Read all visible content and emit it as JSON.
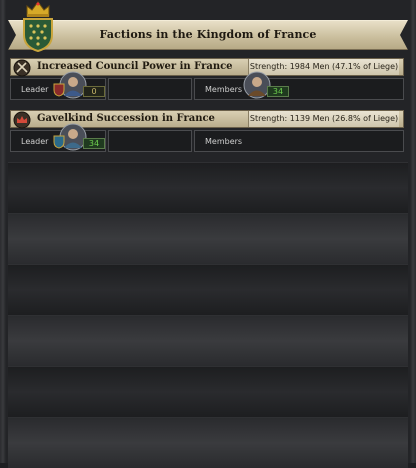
{
  "window": {
    "title": "Factions in the Kingdom of France"
  },
  "factions": [
    {
      "name": "Increased Council Power in France",
      "strength": "Strength: 1984 Men (47.1% of Liege)",
      "leader_label": "Leader",
      "leader_count": "0",
      "members_label": "Members",
      "members_count": "34",
      "icon": "council-power-icon"
    },
    {
      "name": "Gavelkind Succession in France",
      "strength": "Strength: 1139 Men (26.8% of Liege)",
      "leader_label": "Leader",
      "leader_count": "34",
      "members_label": "Members",
      "icon": "succession-crown-icon"
    }
  ],
  "colors": {
    "banner": "#d9cfb3",
    "count_green": "#6fcf4f",
    "count_gold": "#c7b56a"
  }
}
